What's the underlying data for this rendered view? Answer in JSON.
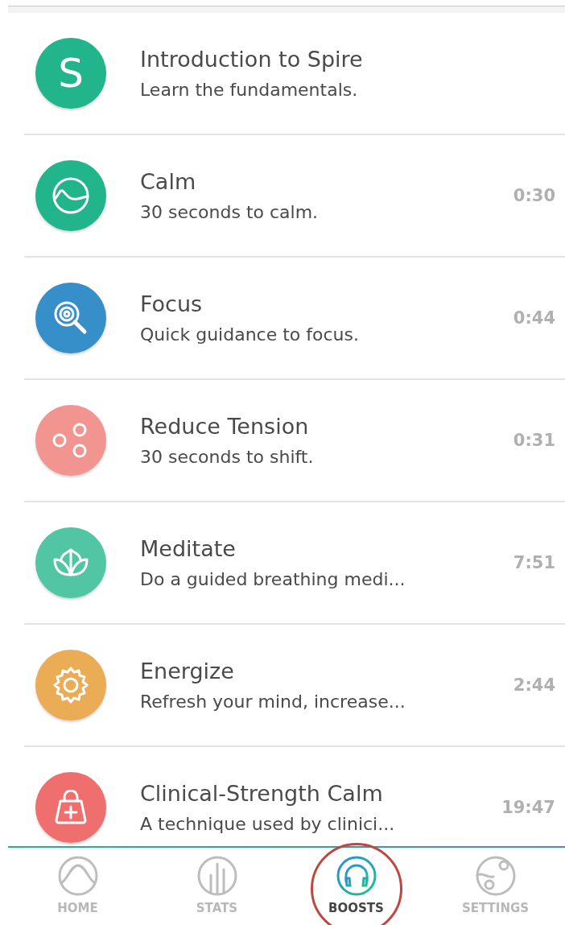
{
  "boosts": [
    {
      "kind": "letter",
      "letter": "S",
      "title": "Introduction to Spire",
      "subtitle": "Learn the fundamentals.",
      "color": "#22b48a"
    },
    {
      "kind": "wave",
      "title": "Calm",
      "subtitle": "30 seconds to calm.",
      "duration": "0:30",
      "color": "#22b48a"
    },
    {
      "kind": "target",
      "title": "Focus",
      "subtitle": "Quick guidance to focus.",
      "duration": "0:44",
      "color": "#368fc8"
    },
    {
      "kind": "dots",
      "title": "Reduce Tension",
      "subtitle": "30 seconds to shift.",
      "duration": "0:31",
      "color": "#f29490"
    },
    {
      "kind": "lotus",
      "title": "Meditate",
      "subtitle": "Do a guided breathing medi...",
      "duration": "7:51",
      "color": "#52c6a4"
    },
    {
      "kind": "gear",
      "title": "Energize",
      "subtitle": "Refresh your mind, increase...",
      "duration": "2:44",
      "color": "#eaac55"
    },
    {
      "kind": "kit",
      "title": "Clinical-Strength Calm",
      "subtitle": "A technique used by clinici...",
      "duration": "19:47",
      "color": "#ef6f6f"
    }
  ],
  "tabs": [
    {
      "kind": "home",
      "label": "HOME",
      "selected": false,
      "circled": false
    },
    {
      "kind": "stats",
      "label": "STATS",
      "selected": false,
      "circled": false
    },
    {
      "kind": "boosts",
      "label": "BOOSTS",
      "selected": true,
      "circled": true
    },
    {
      "kind": "settings",
      "label": "SETTINGS",
      "selected": false,
      "circled": false
    }
  ]
}
